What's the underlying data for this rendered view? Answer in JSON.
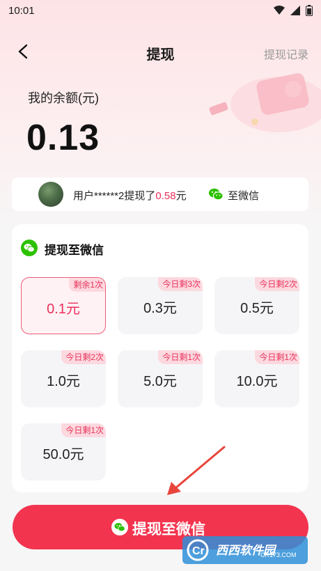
{
  "status_bar": {
    "time": "10:01"
  },
  "nav": {
    "title": "提现",
    "right_link": "提现记录"
  },
  "balance": {
    "label": "我的余额(元)",
    "value": "0.13"
  },
  "notice": {
    "prefix": "用户******2提现了",
    "amount": "0.58",
    "suffix": "元",
    "destination": "至微信"
  },
  "card": {
    "title": "提现至微信",
    "options": [
      {
        "value": "0.1元",
        "badge": "剩余1次",
        "selected": true
      },
      {
        "value": "0.3元",
        "badge": "今日剩3次",
        "selected": false
      },
      {
        "value": "0.5元",
        "badge": "今日剩2次",
        "selected": false
      },
      {
        "value": "1.0元",
        "badge": "今日剩2次",
        "selected": false
      },
      {
        "value": "5.0元",
        "badge": "今日剩1次",
        "selected": false
      },
      {
        "value": "10.0元",
        "badge": "今日剩1次",
        "selected": false
      },
      {
        "value": "50.0元",
        "badge": "今日剩1次",
        "selected": false
      }
    ]
  },
  "submit": {
    "label": "提现至微信"
  },
  "watermark": {
    "text": "西西软件园",
    "sub": "CR173.COM"
  },
  "colors": {
    "accent": "#f3344f",
    "wechat": "#2dc100",
    "badge_text": "#e8305a"
  },
  "icons": [
    "back-chevron-icon",
    "wechat-icon",
    "wifi-icon",
    "signal-icon",
    "battery-icon",
    "annotation-arrow-icon"
  ]
}
